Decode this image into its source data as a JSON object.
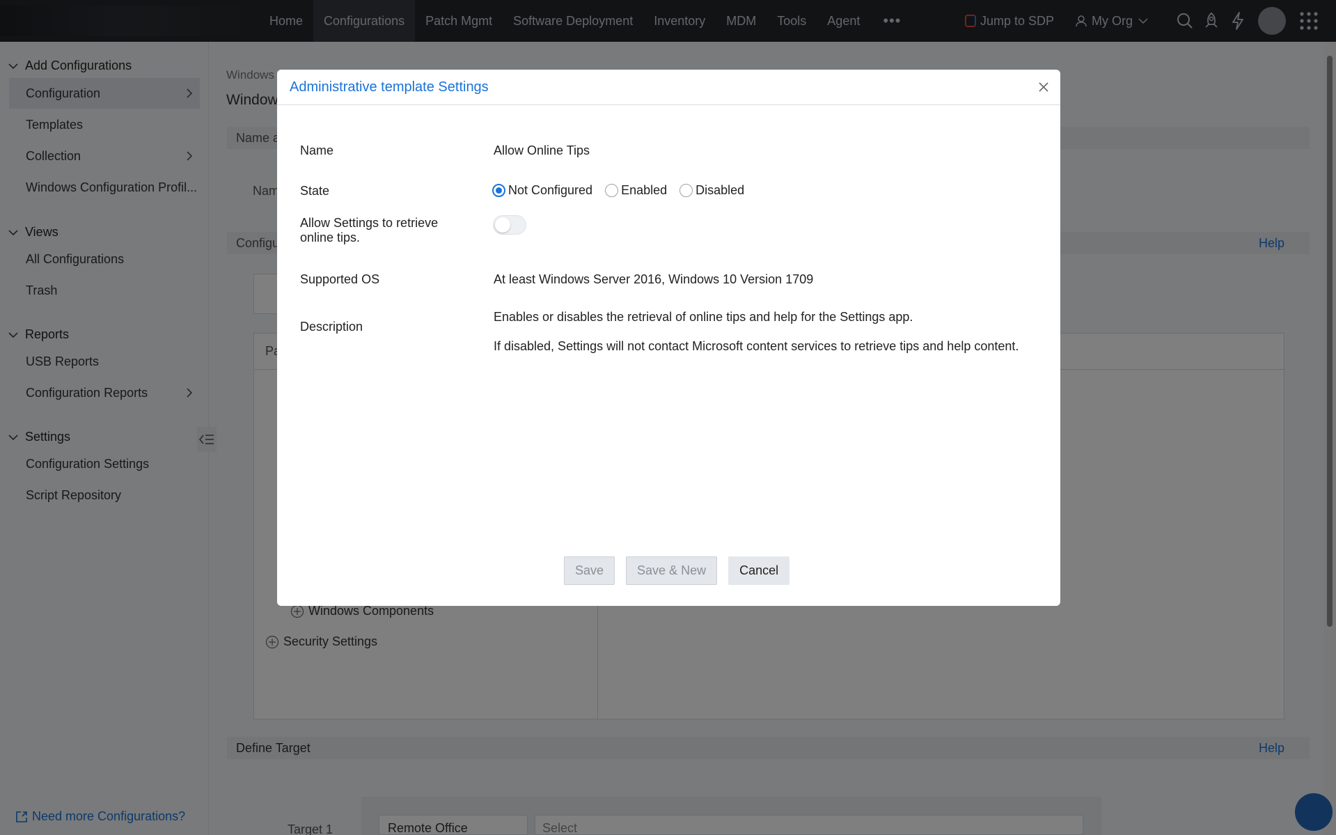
{
  "nav": {
    "items": [
      {
        "label": "Home",
        "active": false,
        "name": "nav-home"
      },
      {
        "label": "Configurations",
        "active": true,
        "name": "nav-configurations"
      },
      {
        "label": "Patch Mgmt",
        "active": false,
        "name": "nav-patch-mgmt"
      },
      {
        "label": "Software Deployment",
        "active": false,
        "name": "nav-software-deployment"
      },
      {
        "label": "Inventory",
        "active": false,
        "name": "nav-inventory"
      },
      {
        "label": "MDM",
        "active": false,
        "name": "nav-mdm"
      },
      {
        "label": "Tools",
        "active": false,
        "name": "nav-tools"
      },
      {
        "label": "Agent",
        "active": false,
        "name": "nav-agent"
      }
    ],
    "more": "•••",
    "jump_label": "Jump to SDP",
    "org_label": "My Org"
  },
  "sidebar": {
    "add_configurations": "Add Configurations",
    "configuration": "Configuration",
    "templates": "Templates",
    "collection": "Collection",
    "windows_profile": "Windows Configuration Profil...",
    "views": "Views",
    "all_configurations": "All Configurations",
    "trash": "Trash",
    "reports": "Reports",
    "usb_reports": "USB Reports",
    "configuration_reports": "Configuration Reports",
    "settings": "Settings",
    "configuration_settings": "Configuration Settings",
    "script_repository": "Script Repository",
    "need_more": "Need more Configurations?"
  },
  "background": {
    "crumb": "Windows",
    "heading": "Window",
    "name_bar": "Name a",
    "name_label": "Nam",
    "config_bar": "Configu",
    "help": "Help",
    "pa_label": "Pa",
    "windows_components": "Windows Components",
    "security_settings": "Security Settings",
    "define_target": "Define Target",
    "target_label": "Target 1",
    "target_type": "Remote Office",
    "target_select": "Select"
  },
  "modal": {
    "title": "Administrative template Settings",
    "name_label": "Name",
    "name_value": "Allow Online Tips",
    "state_label": "State",
    "state_options": [
      {
        "label": "Not Configured",
        "checked": true,
        "name": "radio-not-configured"
      },
      {
        "label": "Enabled",
        "checked": false,
        "name": "radio-enabled"
      },
      {
        "label": "Disabled",
        "checked": false,
        "name": "radio-disabled"
      }
    ],
    "allow_label": "Allow Settings to retrieve online tips.",
    "allow_toggle_on": false,
    "os_label": "Supported OS",
    "os_value": "At least Windows Server 2016, Windows 10 Version 1709",
    "desc_label": "Description",
    "desc_lines": [
      "Enables or disables the retrieval of online tips and help for the Settings app.",
      "If disabled, Settings will not contact Microsoft content services to retrieve tips and help content."
    ],
    "save": "Save",
    "save_new": "Save & New",
    "cancel": "Cancel"
  }
}
